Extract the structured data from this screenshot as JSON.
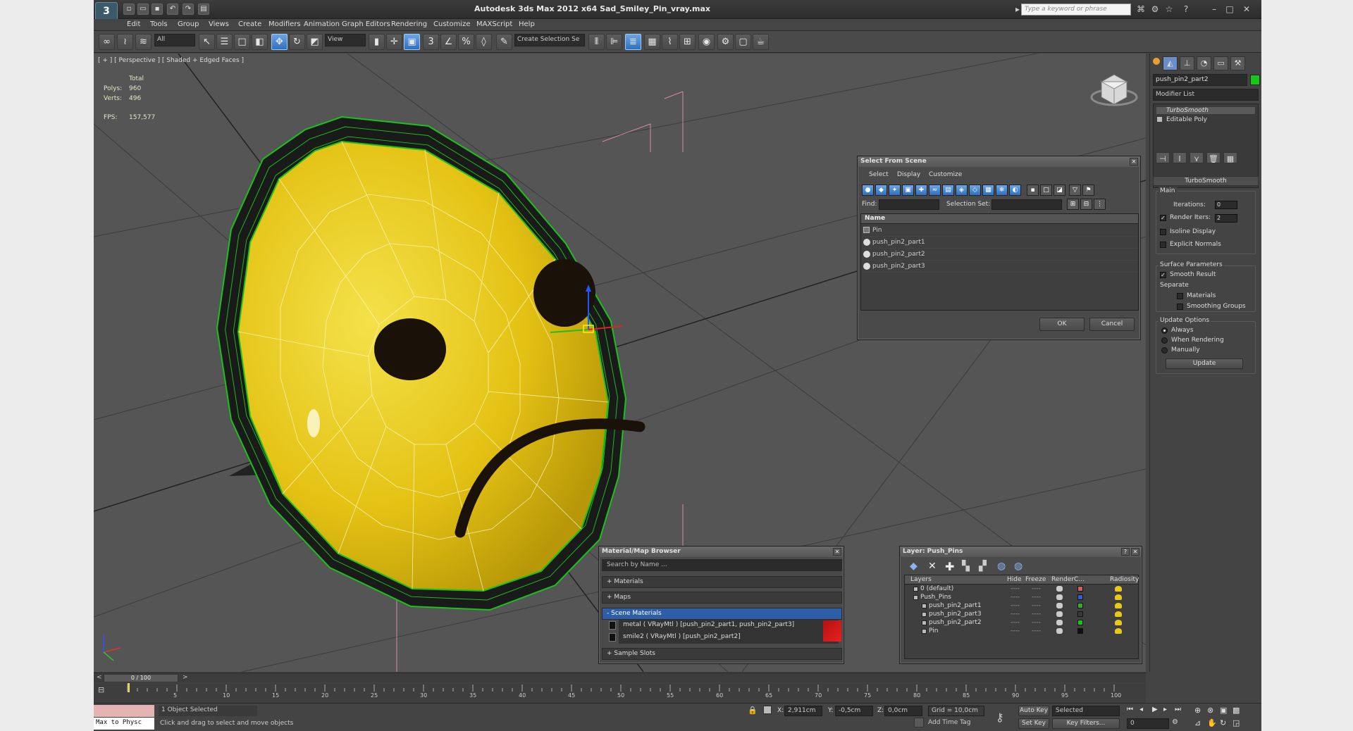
{
  "window": {
    "title": "Autodesk 3ds Max  2012 x64     Sad_Smiley_Pin_vray.max",
    "logo": "3",
    "search_placeholder": "Type a keyword or phrase"
  },
  "menu": [
    "Edit",
    "Tools",
    "Group",
    "Views",
    "Create",
    "Modifiers",
    "Animation",
    "Graph Editors",
    "Rendering",
    "Customize",
    "MAXScript",
    "Help"
  ],
  "toolbar": {
    "filter": "All",
    "ref_coord": "View",
    "named_selection": "Create Selection Se"
  },
  "viewport": {
    "label": "[ + ] [ Perspective ] [ Shaded + Edged Faces ]",
    "stats": {
      "total_label": "Total",
      "polys_label": "Polys:",
      "polys": "960",
      "verts_label": "Verts:",
      "verts": "496",
      "fps_label": "FPS:",
      "fps": "157,577"
    }
  },
  "command_panel": {
    "object_name": "push_pin2_part2",
    "object_color": "#17c917",
    "modifier_list": "Modifier List",
    "stack": [
      "TurboSmooth",
      "Editable Poly"
    ],
    "turbosmooth": {
      "title": "TurboSmooth",
      "main": "Main",
      "iterations_label": "Iterations:",
      "iterations": "0",
      "render_iters_label": "Render Iters:",
      "render_iters": "2",
      "isoline": "Isoline Display",
      "explicit_normals": "Explicit Normals",
      "surface_params": "Surface Parameters",
      "smooth_result": "Smooth Result",
      "separate": "Separate",
      "materials": "Materials",
      "smoothing_groups": "Smoothing Groups",
      "update_options": "Update Options",
      "always": "Always",
      "when_rendering": "When Rendering",
      "manually": "Manually",
      "update_btn": "Update"
    }
  },
  "select_from_scene": {
    "title": "Select From Scene",
    "menus": [
      "Select",
      "Display",
      "Customize"
    ],
    "find_label": "Find:",
    "selection_set_label": "Selection Set:",
    "column_name": "Name",
    "items": [
      "Pin",
      "push_pin2_part1",
      "push_pin2_part2",
      "push_pin2_part3"
    ],
    "ok": "OK",
    "cancel": "Cancel"
  },
  "material_browser": {
    "title": "Material/Map Browser",
    "search_placeholder": "Search by Name ...",
    "sections": [
      "+ Materials",
      "+ Maps",
      "- Scene Materials",
      "+ Sample Slots"
    ],
    "scene_materials": [
      "metal  ( VRayMtl )  [push_pin2_part1, push_pin2_part3]",
      "smile2  ( VRayMtl )  [push_pin2_part2]"
    ]
  },
  "layer_dialog": {
    "title": "Layer: Push_Pins",
    "columns": [
      "Layers",
      "Hide",
      "Freeze",
      "Render",
      "C...",
      "Radiosity"
    ],
    "rows": [
      {
        "name": "0 (default)",
        "dash1": "----",
        "dash2": "----",
        "color": "#d06060",
        "indent": 0
      },
      {
        "name": "Push_Pins",
        "dash1": "----",
        "dash2": "----",
        "color": "#3a5ad0",
        "indent": 0
      },
      {
        "name": "push_pin2_part1",
        "dash1": "----",
        "dash2": "----",
        "color": "#2bb02b",
        "indent": 1
      },
      {
        "name": "push_pin2_part3",
        "dash1": "----",
        "dash2": "----",
        "color": "#3a3a3a",
        "indent": 1
      },
      {
        "name": "push_pin2_part2",
        "dash1": "----",
        "dash2": "----",
        "color": "#17c917",
        "indent": 1
      },
      {
        "name": "Pin",
        "dash1": "----",
        "dash2": "----",
        "color": "#111111",
        "indent": 1
      }
    ]
  },
  "timeline": {
    "frame": "0 / 100",
    "ticks": [
      "5",
      "10",
      "15",
      "20",
      "25",
      "30",
      "35",
      "40",
      "45",
      "50",
      "55",
      "60",
      "65",
      "70",
      "75",
      "80",
      "85",
      "90",
      "95",
      "100"
    ]
  },
  "status": {
    "maxscript": "Max to Physc",
    "selected": "1 Object Selected",
    "prompt": "Click and drag to select and move objects",
    "x_label": "X:",
    "x": "2,911cm",
    "y_label": "Y:",
    "y": "-0,5cm",
    "z_label": "Z:",
    "z": "0,0cm",
    "grid": "Grid = 10,0cm",
    "add_time_tag": "Add Time Tag",
    "auto_key": "Auto Key",
    "set_key": "Set Key",
    "key_mode": "Selected",
    "key_filters": "Key Filters...",
    "frame_field": "0"
  }
}
